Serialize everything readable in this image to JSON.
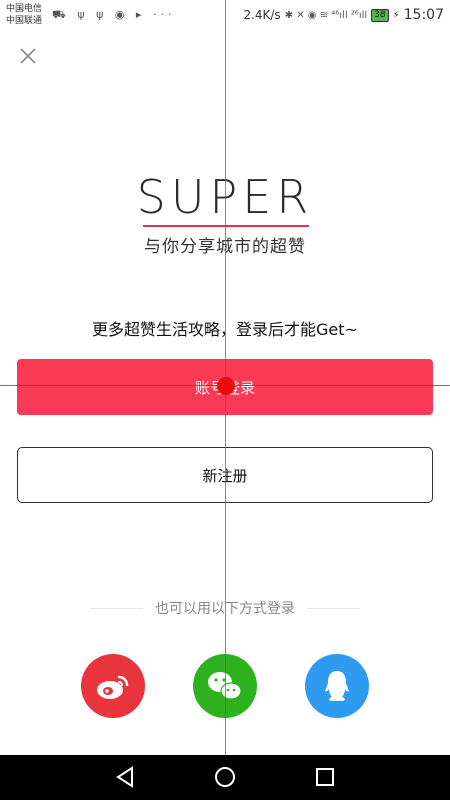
{
  "status_bar": {
    "carrier_1": "中国电信",
    "carrier_2": "中国联通",
    "notif_icons": "⛟ ψ ψ ◉ ▸ ···",
    "net_speed": "2.4K/s",
    "signal_icons": "✱ ✕ ◉ ≋ ⁴⁶ıll ²⁶ıll",
    "battery": "38",
    "time": "15:07"
  },
  "close_icon": "close-icon",
  "logo": {
    "title": "SUPER",
    "subtitle": "与你分享城市的超赞",
    "accent_color": "#e8324f"
  },
  "prompt": "更多超赞生活攻略，登录后才能Get~",
  "buttons": {
    "account_login": "账号登录",
    "register": "新注册"
  },
  "alt_login_label": "也可以用以下方式登录",
  "social": {
    "weibo_color": "#e8353d",
    "wechat_color": "#2db11e",
    "qq_color": "#2e9bf0"
  },
  "nav": {
    "back": "back-icon",
    "home": "home-icon",
    "recents": "recents-icon"
  }
}
